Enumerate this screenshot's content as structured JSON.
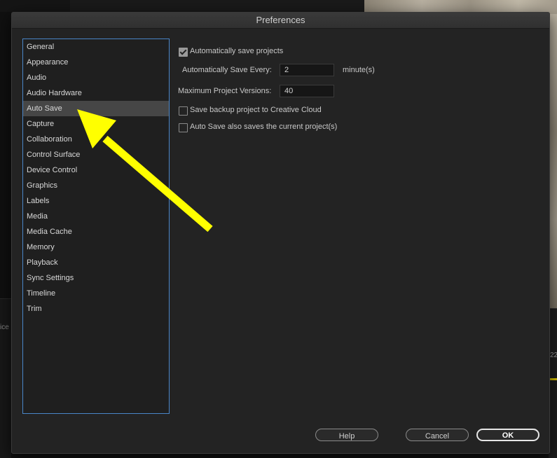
{
  "window": {
    "title": "Preferences"
  },
  "sidebar": {
    "selected": "Auto Save",
    "items": [
      {
        "label": "General"
      },
      {
        "label": "Appearance"
      },
      {
        "label": "Audio"
      },
      {
        "label": "Audio Hardware"
      },
      {
        "label": "Auto Save"
      },
      {
        "label": "Capture"
      },
      {
        "label": "Collaboration"
      },
      {
        "label": "Control Surface"
      },
      {
        "label": "Device Control"
      },
      {
        "label": "Graphics"
      },
      {
        "label": "Labels"
      },
      {
        "label": "Media"
      },
      {
        "label": "Media Cache"
      },
      {
        "label": "Memory"
      },
      {
        "label": "Playback"
      },
      {
        "label": "Sync Settings"
      },
      {
        "label": "Timeline"
      },
      {
        "label": "Trim"
      }
    ]
  },
  "autosave": {
    "auto_save_projects": {
      "label": "Automatically save projects",
      "checked": true
    },
    "save_every": {
      "label": "Automatically Save Every:",
      "value": "2",
      "unit": "minute(s)"
    },
    "max_versions": {
      "label": "Maximum Project Versions:",
      "value": "40"
    },
    "backup_cloud": {
      "label": "Save backup project to Creative Cloud",
      "checked": false
    },
    "save_current": {
      "label": "Auto Save also saves the current project(s)",
      "checked": false
    }
  },
  "buttons": {
    "help": "Help",
    "cancel": "Cancel",
    "ok": "OK"
  },
  "background": {
    "left_fragment": "ice",
    "right_fragment": "22"
  },
  "colors": {
    "annotation_arrow": "#ffff00",
    "selection_border": "#4a86c8"
  }
}
